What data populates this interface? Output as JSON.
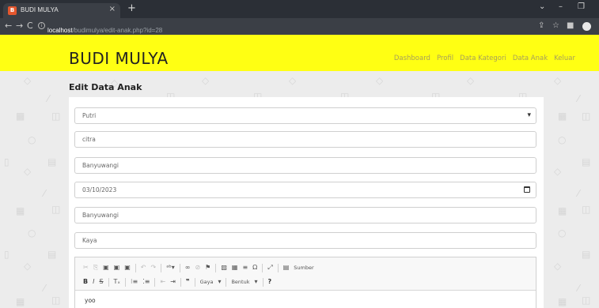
{
  "browser": {
    "tab_title": "BUDI MULYA",
    "tab_close": "×",
    "new_tab": "+",
    "url_host": "localhost",
    "url_path": "/budimulya/edit-anak.php?id=28",
    "win_minimize": "–",
    "win_maximize": "❐",
    "win_chevron": "⌄"
  },
  "header": {
    "brand": "BUDI MULYA",
    "nav": [
      "Dashboard",
      "Profil",
      "Data Kategori",
      "Data Anak",
      "Keluar"
    ],
    "bg_color": "#ffff13"
  },
  "page": {
    "title": "Edit Data Anak"
  },
  "form": {
    "kategori_select": "Putri",
    "nama": "citra",
    "tempat_lahir": "Banyuwangi",
    "tanggal_lahir": "03/10/2023",
    "alamat": "Banyuwangi",
    "status": "Kaya"
  },
  "editor": {
    "combo_style": "Gaya",
    "combo_format": "Bentuk",
    "source_label": "Sumber",
    "help": "?",
    "content": "yoo"
  }
}
